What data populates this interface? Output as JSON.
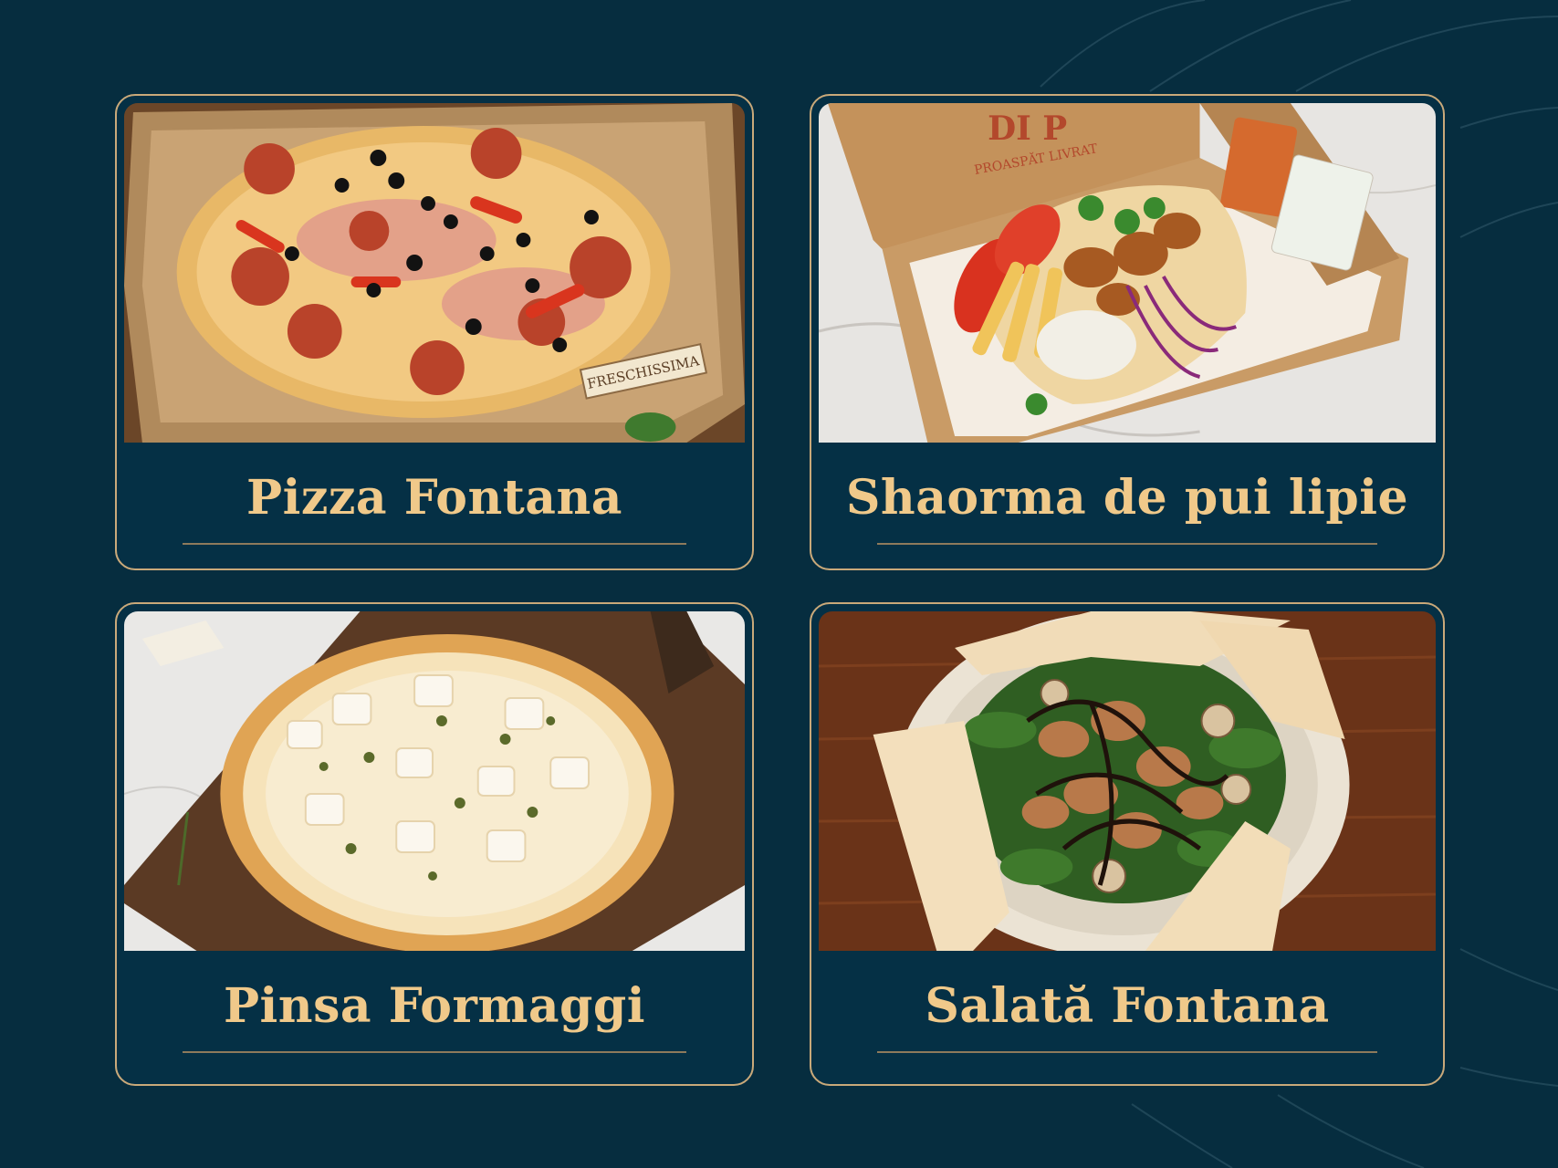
{
  "colors": {
    "background": "#062d3f",
    "card_border": "#c9a97a",
    "caption": "#f0c98a"
  },
  "cards": [
    {
      "title": "Pizza Fontana",
      "photo_label": "FRESCHISSIMA"
    },
    {
      "title": "Shaorma de pui lipie",
      "box_brand": "DI P",
      "box_tagline": "PROASPĂT LIVRAT"
    },
    {
      "title": "Pinsa Formaggi"
    },
    {
      "title": "Salată Fontana"
    }
  ]
}
